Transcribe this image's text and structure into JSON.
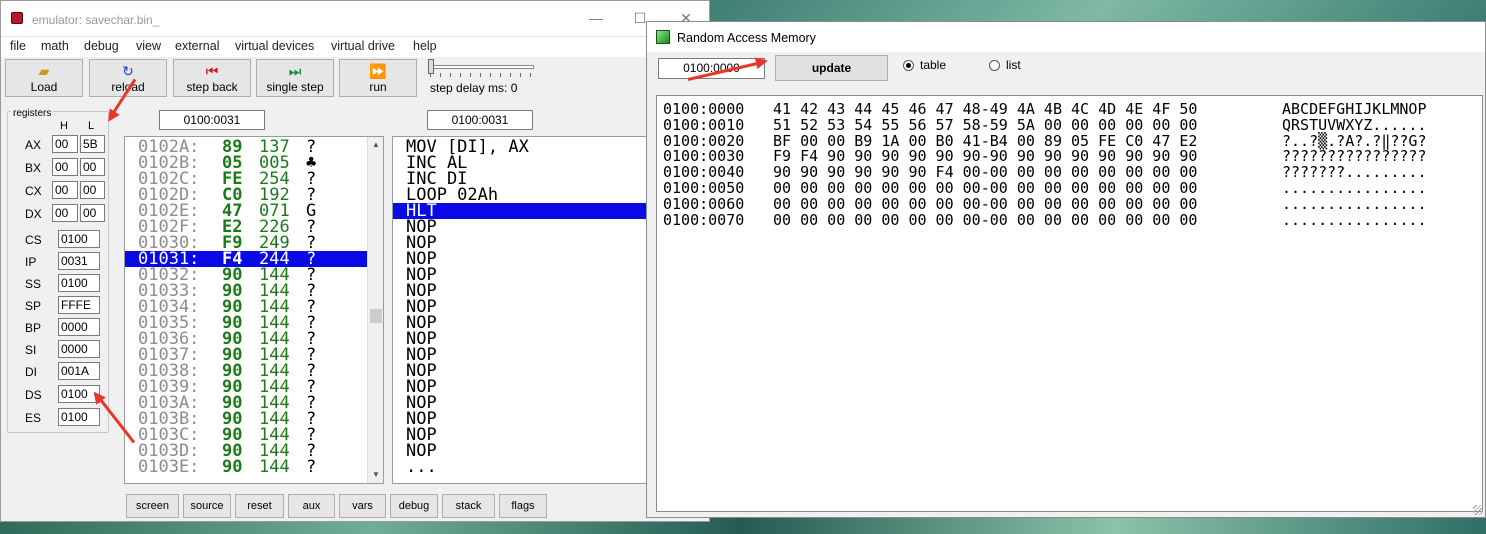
{
  "emulator": {
    "title": "emulator: savechar.bin_",
    "menu": [
      "file",
      "math",
      "debug",
      "view",
      "external",
      "virtual devices",
      "virtual drive",
      "help"
    ],
    "toolbar": {
      "load": "Load",
      "reload": "reload",
      "step_back": "step back",
      "single_step": "single step",
      "run": "run",
      "step_delay": "step delay ms: 0"
    },
    "registers": {
      "legend": "registers",
      "h_header": "H",
      "l_header": "L",
      "ax": {
        "name": "AX",
        "h": "00",
        "l": "5B"
      },
      "bx": {
        "name": "BX",
        "h": "00",
        "l": "00"
      },
      "cx": {
        "name": "CX",
        "h": "00",
        "l": "00"
      },
      "dx": {
        "name": "DX",
        "h": "00",
        "l": "00"
      },
      "cs": {
        "name": "CS",
        "v": "0100"
      },
      "ip": {
        "name": "IP",
        "v": "0031"
      },
      "ss": {
        "name": "SS",
        "v": "0100"
      },
      "sp": {
        "name": "SP",
        "v": "FFFE"
      },
      "bp": {
        "name": "BP",
        "v": "0000"
      },
      "si": {
        "name": "SI",
        "v": "0000"
      },
      "di": {
        "name": "DI",
        "v": "001A"
      },
      "ds": {
        "name": "DS",
        "v": "0100"
      },
      "es": {
        "name": "ES",
        "v": "0100"
      }
    },
    "code_address": "0100:0031",
    "asm_address": "0100:0031",
    "code_rows": [
      {
        "addr": "0102A:",
        "hex": "89",
        "dec": "137",
        "ch": "?"
      },
      {
        "addr": "0102B:",
        "hex": "05",
        "dec": "005",
        "ch": "♣"
      },
      {
        "addr": "0102C:",
        "hex": "FE",
        "dec": "254",
        "ch": "?"
      },
      {
        "addr": "0102D:",
        "hex": "C0",
        "dec": "192",
        "ch": "?"
      },
      {
        "addr": "0102E:",
        "hex": "47",
        "dec": "071",
        "ch": "G"
      },
      {
        "addr": "0102F:",
        "hex": "E2",
        "dec": "226",
        "ch": "?"
      },
      {
        "addr": "01030:",
        "hex": "F9",
        "dec": "249",
        "ch": "?"
      },
      {
        "addr": "01031:",
        "hex": "F4",
        "dec": "244",
        "ch": "?"
      },
      {
        "addr": "01032:",
        "hex": "90",
        "dec": "144",
        "ch": "?"
      },
      {
        "addr": "01033:",
        "hex": "90",
        "dec": "144",
        "ch": "?"
      },
      {
        "addr": "01034:",
        "hex": "90",
        "dec": "144",
        "ch": "?"
      },
      {
        "addr": "01035:",
        "hex": "90",
        "dec": "144",
        "ch": "?"
      },
      {
        "addr": "01036:",
        "hex": "90",
        "dec": "144",
        "ch": "?"
      },
      {
        "addr": "01037:",
        "hex": "90",
        "dec": "144",
        "ch": "?"
      },
      {
        "addr": "01038:",
        "hex": "90",
        "dec": "144",
        "ch": "?"
      },
      {
        "addr": "01039:",
        "hex": "90",
        "dec": "144",
        "ch": "?"
      },
      {
        "addr": "0103A:",
        "hex": "90",
        "dec": "144",
        "ch": "?"
      },
      {
        "addr": "0103B:",
        "hex": "90",
        "dec": "144",
        "ch": "?"
      },
      {
        "addr": "0103C:",
        "hex": "90",
        "dec": "144",
        "ch": "?"
      },
      {
        "addr": "0103D:",
        "hex": "90",
        "dec": "144",
        "ch": "?"
      },
      {
        "addr": "0103E:",
        "hex": "90",
        "dec": "144",
        "ch": "?"
      }
    ],
    "asm_rows": [
      "MOV [DI], AX",
      "INC AL",
      "INC DI",
      "LOOP 02Ah",
      "HLT",
      "NOP",
      "NOP",
      "NOP",
      "NOP",
      "NOP",
      "NOP",
      "NOP",
      "NOP",
      "NOP",
      "NOP",
      "NOP",
      "NOP",
      "NOP",
      "NOP",
      "NOP",
      "..."
    ],
    "bottom_buttons": [
      "screen",
      "source",
      "reset",
      "aux",
      "vars",
      "debug",
      "stack",
      "flags"
    ]
  },
  "ram": {
    "title": "Random Access Memory",
    "address": "0100:0000",
    "update": "update",
    "table": "table",
    "list": "list",
    "rows": [
      {
        "addr": "0100:0000",
        "hex": "41 42 43 44 45 46 47 48-49 4A 4B 4C 4D 4E 4F 50",
        "ascii": "ABCDEFGHIJKLMNOP"
      },
      {
        "addr": "0100:0010",
        "hex": "51 52 53 54 55 56 57 58-59 5A 00 00 00 00 00 00",
        "ascii": "QRSTUVWXYZ......"
      },
      {
        "addr": "0100:0020",
        "hex": "BF 00 00 B9 1A 00 B0 41-B4 00 89 05 FE C0 47 E2",
        "ascii": "?..?▒.?A?.?‖??G?"
      },
      {
        "addr": "0100:0030",
        "hex": "F9 F4 90 90 90 90 90 90-90 90 90 90 90 90 90 90",
        "ascii": "????????????????"
      },
      {
        "addr": "0100:0040",
        "hex": "90 90 90 90 90 90 F4 00-00 00 00 00 00 00 00 00",
        "ascii": "???????........."
      },
      {
        "addr": "0100:0050",
        "hex": "00 00 00 00 00 00 00 00-00 00 00 00 00 00 00 00",
        "ascii": "................"
      },
      {
        "addr": "0100:0060",
        "hex": "00 00 00 00 00 00 00 00-00 00 00 00 00 00 00 00",
        "ascii": "................"
      },
      {
        "addr": "0100:0070",
        "hex": "00 00 00 00 00 00 00 00-00 00 00 00 00 00 00 00",
        "ascii": "................"
      }
    ]
  }
}
